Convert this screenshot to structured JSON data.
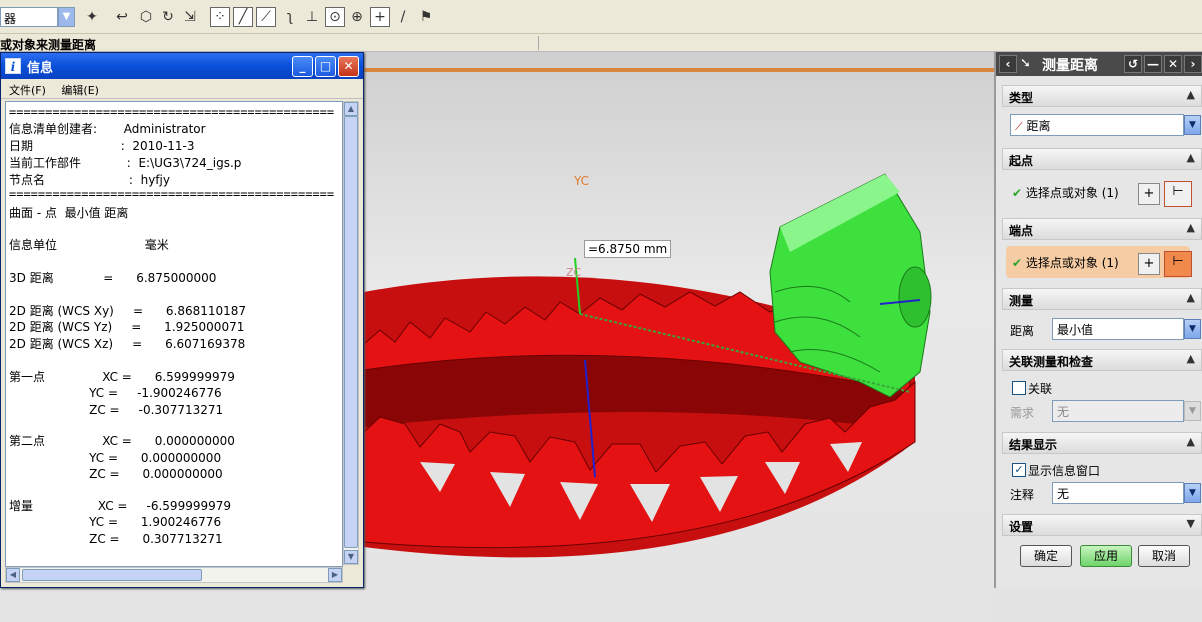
{
  "toolbar": {
    "filter_value": "器",
    "icons": [
      "snap-point-icon",
      "undo-icon",
      "box-icon",
      "rotate-icon",
      "transform-icon",
      "grid-icon",
      "line-icon",
      "endpoint-icon",
      "curve-icon",
      "cross-icon",
      "circle-center-icon",
      "circle-quadrant-icon",
      "plus-icon",
      "slash-icon",
      "flag-icon"
    ]
  },
  "cue": "或对象来测量距离",
  "measurement_label": "=6.8750 mm",
  "axis_labels": {
    "yc": "YC",
    "zc": "ZC"
  },
  "info": {
    "title": "信息",
    "menu": [
      "文件(F)",
      "编辑(E)"
    ],
    "lines": [
      "=============================================",
      "信息清单创建者:       Administrator",
      "日期                       :  2010-11-3",
      "当前工作部件            :  E:\\UG3\\724_igs.p",
      "节点名                      :  hyfjy",
      "=============================================",
      "曲面 - 点  最小值 距离",
      "",
      "信息单位                       毫米",
      "",
      "3D 距离             =      6.875000000",
      "",
      "2D 距离 (WCS Xy)     =      6.868110187",
      "2D 距离 (WCS Yz)     =      1.925000071",
      "2D 距离 (WCS Xz)     =      6.607169378",
      "",
      "第一点               XC =      6.599999979",
      "                     YC =     -1.900246776",
      "                     ZC =     -0.307713271",
      "",
      "第二点               XC =      0.000000000",
      "                     YC =      0.000000000",
      "                     ZC =      0.000000000",
      "",
      "增量                 XC =     -6.599999979",
      "                     YC =      1.900246776",
      "                     ZC =      0.307713271"
    ]
  },
  "dialog": {
    "title": "测量距离",
    "sections": {
      "type": {
        "label": "类型",
        "value": "距离"
      },
      "start": {
        "label": "起点",
        "pick": "选择点或对象 (1)"
      },
      "end": {
        "label": "端点",
        "pick": "选择点或对象 (1)"
      },
      "measure": {
        "label": "测量",
        "field": "距离",
        "value": "最小值"
      },
      "assoc": {
        "label": "关联测量和检查",
        "checkbox": "关联",
        "req_label": "需求",
        "req_value": "无"
      },
      "result": {
        "label": "结果显示",
        "checkbox": "显示信息窗口",
        "annot_label": "注释",
        "annot_value": "无"
      },
      "settings": {
        "label": "设置"
      }
    },
    "buttons": {
      "ok": "确定",
      "apply": "应用",
      "cancel": "取消"
    }
  },
  "colors": {
    "gear_ring": "#e41212",
    "gear_pinion": "#3ee03e",
    "accent": "#0a4fd8"
  }
}
